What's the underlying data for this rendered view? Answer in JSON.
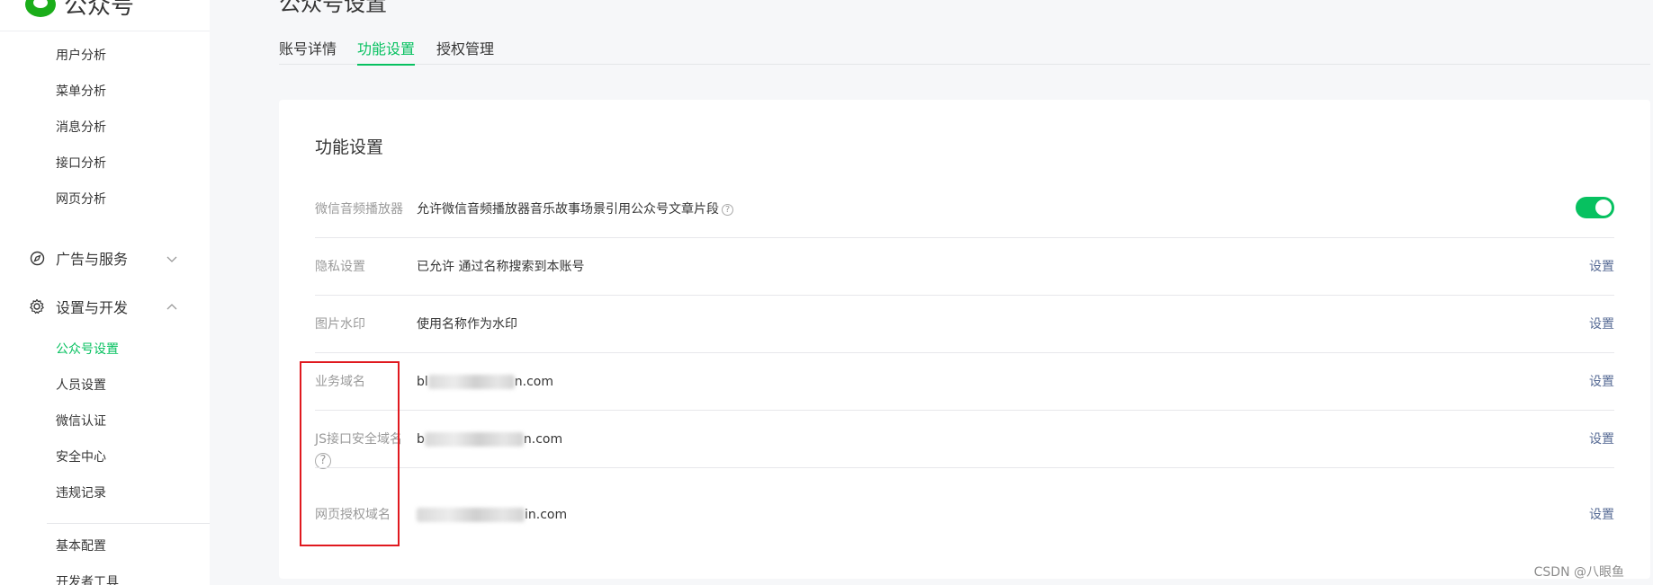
{
  "sidebar": {
    "brand": "公众号",
    "analysis_items": [
      "用户分析",
      "菜单分析",
      "消息分析",
      "接口分析",
      "网页分析"
    ],
    "groups": {
      "ads": "广告与服务",
      "settings": "设置与开发"
    },
    "settings_items": [
      "公众号设置",
      "人员设置",
      "微信认证",
      "安全中心",
      "违规记录"
    ],
    "dev_items": [
      "基本配置",
      "开发者工具"
    ]
  },
  "header": {
    "title": "公众号设置",
    "tabs": [
      "账号详情",
      "功能设置",
      "授权管理"
    ]
  },
  "card": {
    "title": "功能设置",
    "rows": [
      {
        "label": "微信音频播放器",
        "value": "允许微信音频播放器音乐故事场景引用公众号文章片段"
      },
      {
        "label": "隐私设置",
        "value": "已允许 通过名称搜索到本账号",
        "action": "设置"
      },
      {
        "label": "图片水印",
        "value": "使用名称作为水印",
        "action": "设置"
      },
      {
        "label": "业务域名",
        "value_prefix": "bl",
        "value_suffix": "n.com",
        "action": "设置"
      },
      {
        "label": "JS接口安全域名",
        "value_prefix": "b",
        "value_suffix": "n.com",
        "action": "设置"
      },
      {
        "label": "网页授权域名",
        "value_prefix": "",
        "value_suffix": "in.com",
        "action": "设置"
      }
    ]
  },
  "watermark": "CSDN @八眼鱼",
  "colors": {
    "accent": "#07c160",
    "link": "#576b95",
    "highlight": "#e0191f"
  },
  "icons": {
    "ads": "compass-icon",
    "settings": "gear-icon",
    "help": "question-circle-icon"
  }
}
